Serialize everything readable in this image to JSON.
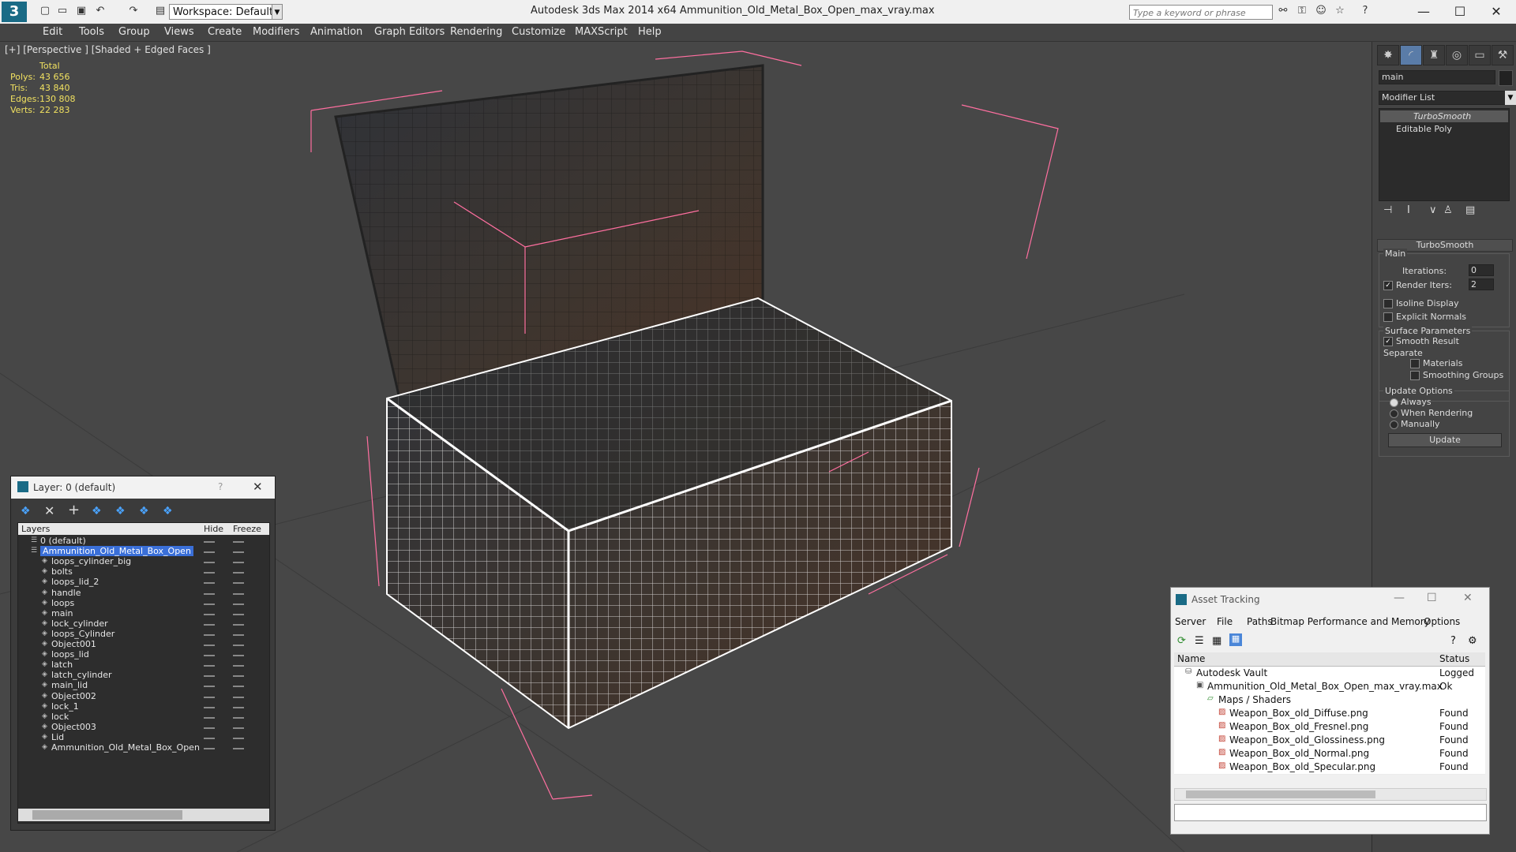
{
  "app": {
    "title": "Autodesk 3ds Max  2014 x64      Ammunition_Old_Metal_Box_Open_max_vray.max",
    "workspace": "Workspace: Default",
    "search_placeholder": "Type a keyword or phrase"
  },
  "menu": [
    "Edit",
    "Tools",
    "Group",
    "Views",
    "Create",
    "Modifiers",
    "Animation",
    "Graph Editors",
    "Rendering",
    "Customize",
    "MAXScript",
    "Help"
  ],
  "viewport": {
    "label": "[+] [Perspective ] [Shaded + Edged Faces ]",
    "stats": {
      "header": "Total",
      "rows": [
        {
          "label": "Polys:",
          "value": "43 656"
        },
        {
          "label": "Tris:",
          "value": "43 840"
        },
        {
          "label": "Edges:",
          "value": "130 808"
        },
        {
          "label": "Verts:",
          "value": "22 283"
        }
      ]
    }
  },
  "command_panel": {
    "object_name": "main",
    "modifier_list": "Modifier List",
    "stack": [
      "TurboSmooth",
      "Editable Poly"
    ],
    "rollout_title": "TurboSmooth",
    "main_group": "Main",
    "iterations_label": "Iterations:",
    "iterations_value": "0",
    "render_iters_label": "Render Iters:",
    "render_iters_value": "2",
    "isoline": "Isoline Display",
    "explicit": "Explicit Normals",
    "surface_group": "Surface Parameters",
    "smooth_result": "Smooth Result",
    "separate": "Separate",
    "materials": "Materials",
    "smoothing_groups": "Smoothing Groups",
    "update_group": "Update Options",
    "always": "Always",
    "when_rendering": "When Rendering",
    "manually": "Manually",
    "update_button": "Update"
  },
  "layer_window": {
    "title": "Layer: 0 (default)",
    "help": "?",
    "columns": [
      "Layers",
      "Hide",
      "Freeze"
    ],
    "layers": [
      "0 (default)",
      "Ammunition_Old_Metal_Box_Open"
    ],
    "objects": [
      "loops_cylinder_big",
      "bolts",
      "loops_lid_2",
      "handle",
      "loops",
      "main",
      "lock_cylinder",
      "loops_Cylinder",
      "Object001",
      "loops_lid",
      "latch",
      "latch_cylinder",
      "main_lid",
      "Object002",
      "lock_1",
      "lock",
      "Object003",
      "Lid",
      "Ammunition_Old_Metal_Box_Open"
    ]
  },
  "asset_tracking": {
    "title": "Asset Tracking",
    "menu": [
      "Server",
      "File",
      "Paths",
      "Bitmap Performance and Memory",
      "Options"
    ],
    "columns": [
      "Name",
      "Status"
    ],
    "rows": [
      {
        "name": "Autodesk Vault",
        "status": "Logged Ou"
      },
      {
        "name": "Ammunition_Old_Metal_Box_Open_max_vray.max",
        "status": "Ok"
      },
      {
        "name": "Maps / Shaders",
        "status": ""
      },
      {
        "name": "Weapon_Box_old_Diffuse.png",
        "status": "Found"
      },
      {
        "name": "Weapon_Box_old_Fresnel.png",
        "status": "Found"
      },
      {
        "name": "Weapon_Box_old_Glossiness.png",
        "status": "Found"
      },
      {
        "name": "Weapon_Box_old_Normal.png",
        "status": "Found"
      },
      {
        "name": "Weapon_Box_old_Specular.png",
        "status": "Found"
      }
    ]
  },
  "colors": {
    "viewport_bg": "#474747",
    "selection": "#3a6fd8",
    "wire": "#ffffff",
    "bounding_box": "#ff6fa0"
  }
}
